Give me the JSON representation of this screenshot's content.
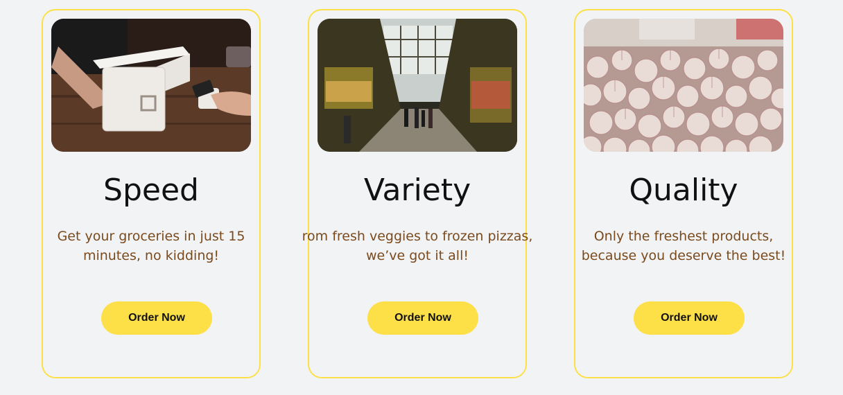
{
  "cards": [
    {
      "title": "Speed",
      "description_line1": "Get your groceries in just 15",
      "description_line2": "minutes, no kidding!",
      "button_label": "Order Now",
      "image": "checkout-terminal-photo"
    },
    {
      "title": "Variety",
      "description_line1": "rom fresh veggies to frozen pizzas,",
      "description_line2": "we’ve got it all!",
      "button_label": "Order Now",
      "image": "food-market-hall-photo"
    },
    {
      "title": "Quality",
      "description_line1": "Only the freshest products,",
      "description_line2": "because you deserve the best!",
      "button_label": "Order Now",
      "image": "garlic-bulbs-photo"
    }
  ],
  "colors": {
    "accent": "#fde047",
    "background": "#f2f3f5",
    "description_text": "#7a4a1d",
    "title_text": "#111111"
  }
}
